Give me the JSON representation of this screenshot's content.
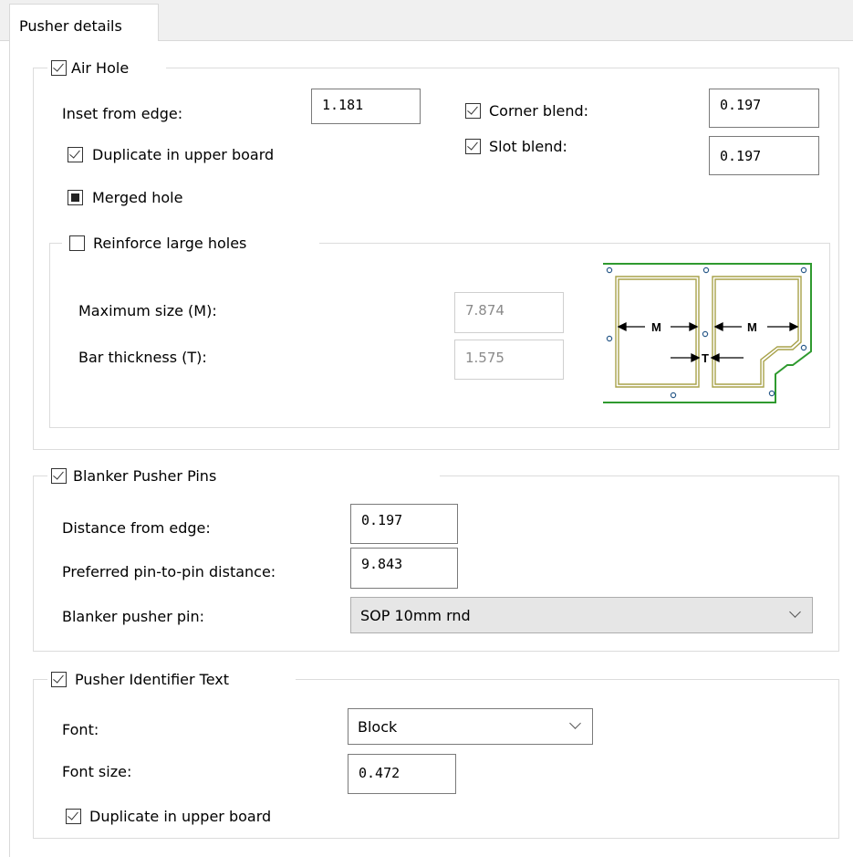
{
  "tab": {
    "label": "Pusher details"
  },
  "air_hole": {
    "title": "Air Hole",
    "checked": true,
    "inset_label": "Inset from edge:",
    "inset_value": "1.181",
    "corner_blend_label": "Corner blend:",
    "corner_blend_value": "0.197",
    "slot_blend_label": "Slot blend:",
    "slot_blend_value": "0.197",
    "duplicate_label": "Duplicate in upper board",
    "merged_label": "Merged hole",
    "reinforce": {
      "title": "Reinforce large holes",
      "max_size_label": "Maximum size (M):",
      "max_size_value": "7.874",
      "bar_thickness_label": "Bar thickness (T):",
      "bar_thickness_value": "1.575",
      "diagram": {
        "m_label": "M",
        "t_label": "T"
      }
    }
  },
  "blanker_pins": {
    "title": "Blanker Pusher Pins",
    "distance_label": "Distance from edge:",
    "distance_value": "0.197",
    "pin_distance_label": "Preferred pin-to-pin distance:",
    "pin_distance_value": "9.843",
    "pin_label": "Blanker pusher pin:",
    "pin_value": "SOP 10mm rnd"
  },
  "identifier_text": {
    "title": "Pusher Identifier Text",
    "font_label": "Font:",
    "font_value": "Block",
    "font_size_label": "Font size:",
    "font_size_value": "0.472",
    "duplicate_label": "Duplicate in upper board"
  },
  "colors": {
    "diagram_outline": "#2f9a2f",
    "diagram_hole": "#a8a24a"
  }
}
